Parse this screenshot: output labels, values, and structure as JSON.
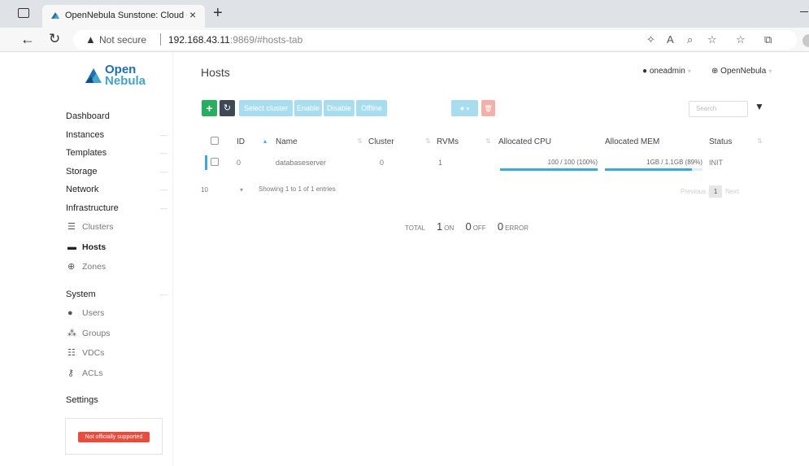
{
  "browser": {
    "tab_title": "OpenNebula Sunstone: Cloud O",
    "tab_close": "×",
    "new_tab": "+",
    "not_secure": "Not secure",
    "url_host": "192.168.43.11",
    "url_path": ":9869/#hosts-tab"
  },
  "sidebar": {
    "logo_line1": "Open",
    "logo_line2": "Nebula",
    "items": {
      "dashboard": "Dashboard",
      "instances": "Instances",
      "templates": "Templates",
      "storage": "Storage",
      "network": "Network",
      "infrastructure": "Infrastructure",
      "clusters": "Clusters",
      "hosts": "Hosts",
      "zones": "Zones",
      "system": "System",
      "users": "Users",
      "groups": "Groups",
      "vdcs": "VDCs",
      "acls": "ACLs",
      "settings": "Settings"
    },
    "support_badge": "Not officially supported"
  },
  "header": {
    "title": "Hosts",
    "user": "oneadmin",
    "zone": "OpenNebula"
  },
  "toolbar": {
    "add": "+",
    "refresh": "↻",
    "select_cluster": "Select cluster",
    "enable": "Enable",
    "disable": "Disable",
    "offline": "Offline",
    "more_caret": "▾",
    "delete": "🗑",
    "search_placeholder": "Search"
  },
  "table": {
    "columns": [
      "ID",
      "Name",
      "Cluster",
      "RVMs",
      "Allocated CPU",
      "Allocated MEM",
      "Status"
    ],
    "rows": [
      {
        "id": "0",
        "name": "databaseserver",
        "cluster": "0",
        "rvms": "1",
        "cpu_text": "100 / 100 (100%)",
        "cpu_fraction": 1.0,
        "mem_text": "1GB / 1.1GB (89%)",
        "mem_fraction": 0.89,
        "status": "INIT"
      }
    ],
    "page_length": "10",
    "info": "Showing 1 to 1 of 1 entries",
    "previous": "Previous",
    "page": "1",
    "next": "Next"
  },
  "totals": {
    "total_label": "TOTAL",
    "on_value": "1",
    "on_label": "ON",
    "off_value": "0",
    "off_label": "OFF",
    "error_value": "0",
    "error_label": "ERROR"
  },
  "colors": {
    "accent": "#3da7e0",
    "add_green": "#27ae60",
    "danger": "#e74c3c"
  }
}
